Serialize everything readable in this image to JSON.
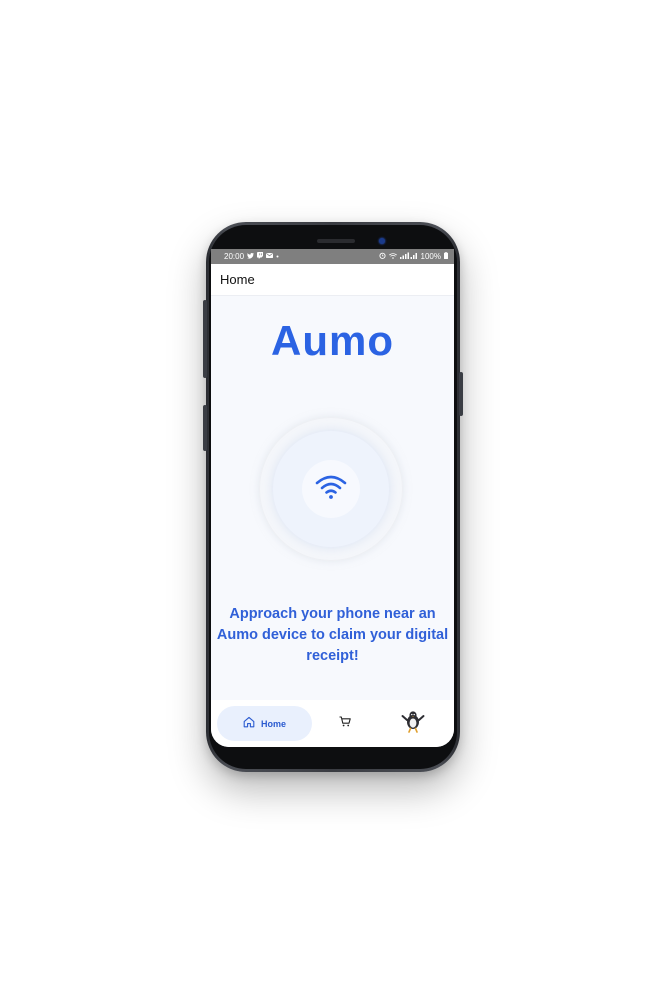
{
  "status_bar": {
    "time": "20:00",
    "battery": "100%"
  },
  "app_bar": {
    "title": "Home"
  },
  "logo": {
    "text": "Aumo"
  },
  "nfc": {
    "icon": "wifi-icon"
  },
  "message": {
    "text": "Approach your phone near an Aumo device to claim your digital receipt!"
  },
  "bottom_nav": {
    "home_label": "Home",
    "home_icon": "home-icon",
    "cart_icon": "cart-icon",
    "profile_icon": "avatar"
  },
  "colors": {
    "brand": "#2b63e3",
    "text_accent": "#3060d8",
    "screen_bg": "#f7f9fd",
    "status_bar": "#7f7f7f"
  }
}
